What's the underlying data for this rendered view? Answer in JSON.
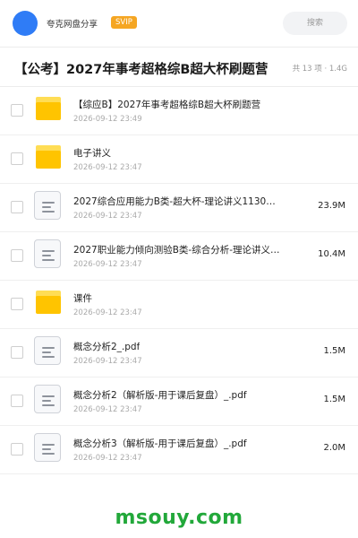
{
  "header": {
    "brand": "夸克网盘分享",
    "badge": "SVIP",
    "search_placeholder": "搜索"
  },
  "folder": {
    "title": "【公考】2027年事考超格综B超大杯刷题营",
    "meta": "共 13 项 · 1.4G"
  },
  "files": [
    {
      "name": "【综应B】2027年事考超格综B超大杯刷题营",
      "date": "2026-09-12 23:49",
      "size": "",
      "type": "folder"
    },
    {
      "name": "电子讲义",
      "date": "2026-09-12 23:47",
      "size": "",
      "type": "folder"
    },
    {
      "name": "2027综合应用能力B类-超大杯-理论讲义1130…",
      "date": "2026-09-12 23:47",
      "size": "23.9M",
      "type": "doc"
    },
    {
      "name": "2027职业能力倾向测验B类-综合分析-理论讲义1…",
      "date": "2026-09-12 23:47",
      "size": "10.4M",
      "type": "doc"
    },
    {
      "name": "课件",
      "date": "2026-09-12 23:47",
      "size": "",
      "type": "folder"
    },
    {
      "name": "概念分析2_.pdf",
      "date": "2026-09-12 23:47",
      "size": "1.5M",
      "type": "doc"
    },
    {
      "name": "概念分析2（解析版-用于课后复盘）_.pdf",
      "date": "2026-09-12 23:47",
      "size": "1.5M",
      "type": "doc"
    },
    {
      "name": "概念分析3（解析版-用于课后复盘）_.pdf",
      "date": "2026-09-12 23:47",
      "size": "2.0M",
      "type": "doc"
    }
  ],
  "watermark": "msouy.com",
  "colors": {
    "accent": "#2f7cf6",
    "folder": "#ffc400",
    "badge": "#f5a623",
    "watermark": "#22a83a"
  }
}
